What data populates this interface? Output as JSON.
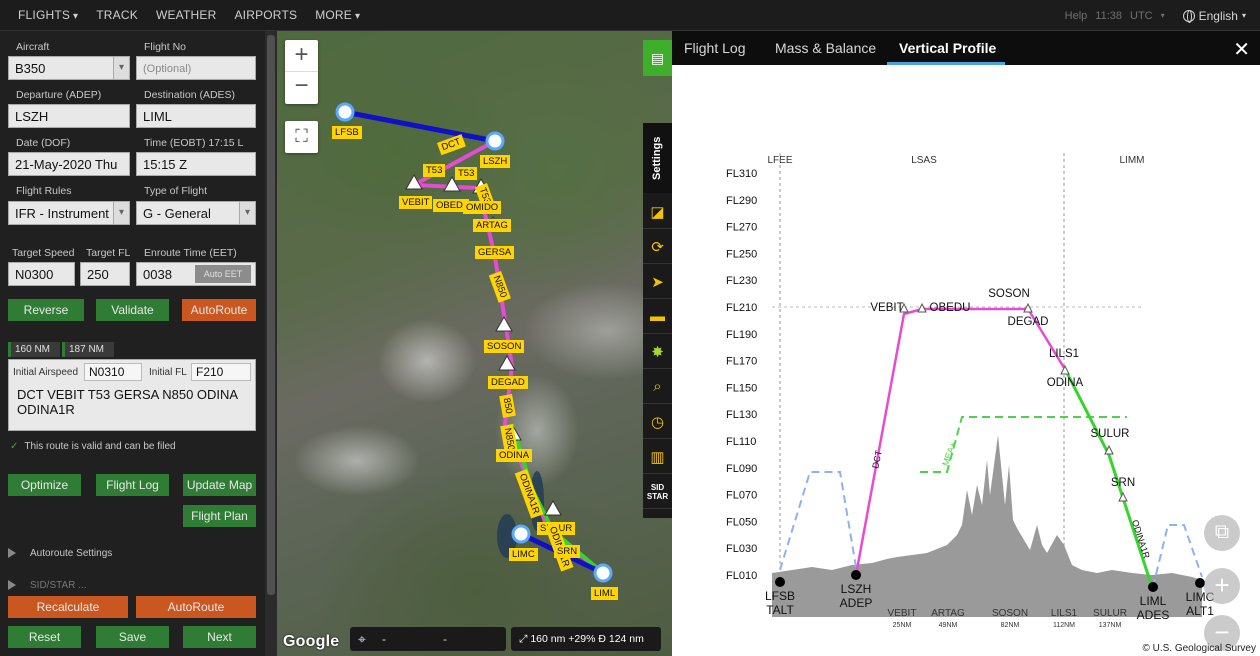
{
  "nav": {
    "items": [
      {
        "label": "FLIGHTS",
        "caret": true
      },
      {
        "label": "TRACK",
        "caret": false
      },
      {
        "label": "WEATHER",
        "caret": false
      },
      {
        "label": "AIRPORTS",
        "caret": false
      },
      {
        "label": "MORE",
        "caret": true
      }
    ],
    "help": "Help",
    "time": "11:38",
    "tz": "UTC",
    "language": "English"
  },
  "form": {
    "aircraft_label": "Aircraft",
    "aircraft": "B350",
    "flightno_label": "Flight No",
    "flightno_placeholder": "(Optional)",
    "dep_label": "Departure (ADEP)",
    "dep": "LSZH",
    "dest_label": "Destination (ADES)",
    "dest": "LIML",
    "date_label": "Date (DOF)",
    "date": "21-May-2020 Thu",
    "time_label": "Time (EOBT) 17:15 L",
    "time": "15:15 Z",
    "rules_label": "Flight Rules",
    "rules": "IFR - Instrument",
    "type_label": "Type of Flight",
    "type": "G - General",
    "speed_label": "Target Speed",
    "speed": "N0300",
    "fl_label": "Target FL",
    "fl": "250",
    "eet_label": "Enroute Time (EET)",
    "eet": "0038",
    "auto_eet": "Auto EET"
  },
  "buttons": {
    "reverse": "Reverse",
    "validate": "Validate",
    "autoroute": "AutoRoute",
    "optimize": "Optimize",
    "flight_log": "Flight Log",
    "update_map": "Update Map",
    "flight_plan": "Flight Plan",
    "recalculate": "Recalculate",
    "autoroute2": "AutoRoute",
    "reset": "Reset",
    "save": "Save",
    "next": "Next"
  },
  "route": {
    "dist1": "160 NM",
    "dist2": "187 NM",
    "airspeed_label": "Initial Airspeed",
    "airspeed": "N0310",
    "fl_label": "Initial FL",
    "fl": "F210",
    "text_line1": "DCT VEBIT T53 GERSA N850 ODINA",
    "text_line2": "ODINA1R",
    "valid": "This route is valid and can be filed",
    "autoroute_settings": "Autoroute Settings",
    "partial_section": "SID/STAR ..."
  },
  "map": {
    "labels": [
      "LFSB",
      "LSZH",
      "DCT",
      "T53",
      "T53",
      "T53",
      "VEBIT",
      "OBEDI",
      "OMIDO",
      "ARTAG",
      "GERSA",
      "N850",
      "SOSON",
      "DEGAD",
      "850",
      "N850",
      "ODINA",
      "ODINA1R",
      "SULUR",
      "ODINA1R",
      "LIMC",
      "SRN",
      "LIML"
    ],
    "settings": "Settings",
    "sidstar": "SID STAR",
    "google": "Google",
    "coord_left": "-",
    "coord_right": "-",
    "distance": "160 nm",
    "percent": "+29%",
    "direct": "124 nm"
  },
  "tabs": [
    {
      "label": "Flight Log",
      "active": false
    },
    {
      "label": "Mass & Balance",
      "active": false
    },
    {
      "label": "Vertical Profile",
      "active": true
    }
  ],
  "profile": {
    "firs": [
      "LFEE",
      "LSAS",
      "LIMM"
    ],
    "fl_labels": [
      "FL310",
      "FL290",
      "FL270",
      "FL250",
      "FL230",
      "FL210",
      "FL190",
      "FL170",
      "FL150",
      "FL130",
      "FL110",
      "FL090",
      "FL070",
      "FL050",
      "FL030",
      "FL010"
    ],
    "points": [
      {
        "name": "VEBIT",
        "dist": "25NM"
      },
      {
        "name": "ARTAG",
        "dist": "49NM"
      },
      {
        "name": "SOSON",
        "dist": "82NM"
      },
      {
        "name": "LILS1",
        "dist": "112NM"
      },
      {
        "name": "SULUR",
        "dist": "137NM"
      }
    ],
    "airport_labels": [
      {
        "name": "LFSB",
        "role": "TALT"
      },
      {
        "name": "LSZH",
        "role": "ADEP"
      },
      {
        "name": "LIML",
        "role": "ADES"
      },
      {
        "name": "LIMC",
        "role": "ALT1"
      }
    ],
    "fix_labels": [
      "VEBIT",
      "OBEDU",
      "SOSON",
      "DEGAD",
      "LILS1",
      "ODINA",
      "SULUR",
      "SRN"
    ],
    "segment_labels": [
      "DCT",
      "MEA+",
      "ODINA1R"
    ],
    "credit": "© U.S. Geological Survey"
  },
  "colors": {
    "route_magenta": "#e64bd6",
    "route_green": "#35d52e",
    "route_blue": "#1010c8",
    "alt_dashed": "#8fb1ef",
    "mea_dashed": "#4bd44b",
    "terrain": "#9a9a9a",
    "label_yellow": "#ffd400"
  }
}
